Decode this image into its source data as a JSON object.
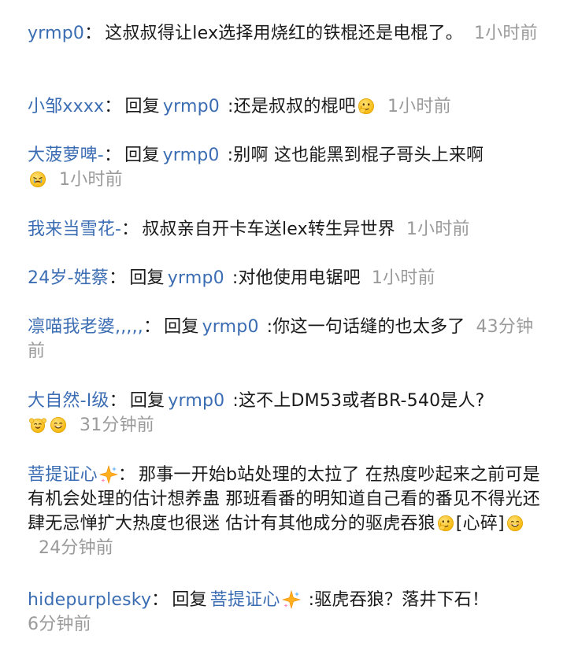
{
  "comments": [
    {
      "user": "yrmp0",
      "sep": "：",
      "text": "这叔叔得让lex选择用烧红的铁棍还是电棍了。",
      "time": "1小时前"
    },
    {
      "user": "小邹xxxx",
      "sep": "：",
      "reply_word": "回复",
      "mention": "yrmp0",
      "text": ":还是叔叔的棍吧",
      "emoji": "thinking-face-icon",
      "time": "1小时前"
    },
    {
      "user": "大菠萝啤-",
      "sep": "：",
      "reply_word": "回复",
      "mention": "yrmp0",
      "text": ":别啊 这也能黑到棍子哥头上来啊",
      "emoji": "angry-cry-face-icon",
      "time": "1小时前"
    },
    {
      "user": "我来当雪花-",
      "sep": "：",
      "text": "叔叔亲自开卡车送lex转生异世界",
      "time": "1小时前"
    },
    {
      "user": "24岁-姓蔡",
      "sep": "：",
      "reply_word": "回复",
      "mention": "yrmp0",
      "text": ":对他使用电锯吧",
      "time": "1小时前"
    },
    {
      "user": "凛喵我老婆,,,,,",
      "sep": "：",
      "reply_word": "回复",
      "mention": "yrmp0",
      "text": ":你这一句话缝的也太多了",
      "time": "43分钟前"
    },
    {
      "user": "大自然-I级",
      "sep": "：",
      "reply_word": "回复",
      "mention": "yrmp0",
      "text": ":这不上DM53或者BR-540是人?",
      "emojis": [
        "cheering-face-icon",
        "smile-face-icon"
      ],
      "time": "31分钟前"
    },
    {
      "user": "菩提证心",
      "user_badge": "sparkle-icon",
      "sep": "：",
      "text": "那事一开始b站处理的太拉了 在热度吵起来之前可是有机会处理的估计想养蛊 那班看番的明知道自己看的番见不得光还肆无忌惮扩大热度也很迷 估计有其他成分的驱虎吞狼",
      "emoji": "thinking-face-icon",
      "sticker": "[心碎]",
      "emoji2": "smile-face-icon",
      "time": "24分钟前"
    },
    {
      "user": "hidepurplesky",
      "sep": "：",
      "reply_word": "回复",
      "mention": "菩提证心",
      "mention_badge": "sparkle-icon",
      "text": ":驱虎吞狼？落井下石！",
      "time": "6分钟前"
    }
  ],
  "colors": {
    "username": "#3b6db3",
    "text": "#1a1a1a",
    "timestamp": "#9a9a9a",
    "background": "#ffffff"
  }
}
